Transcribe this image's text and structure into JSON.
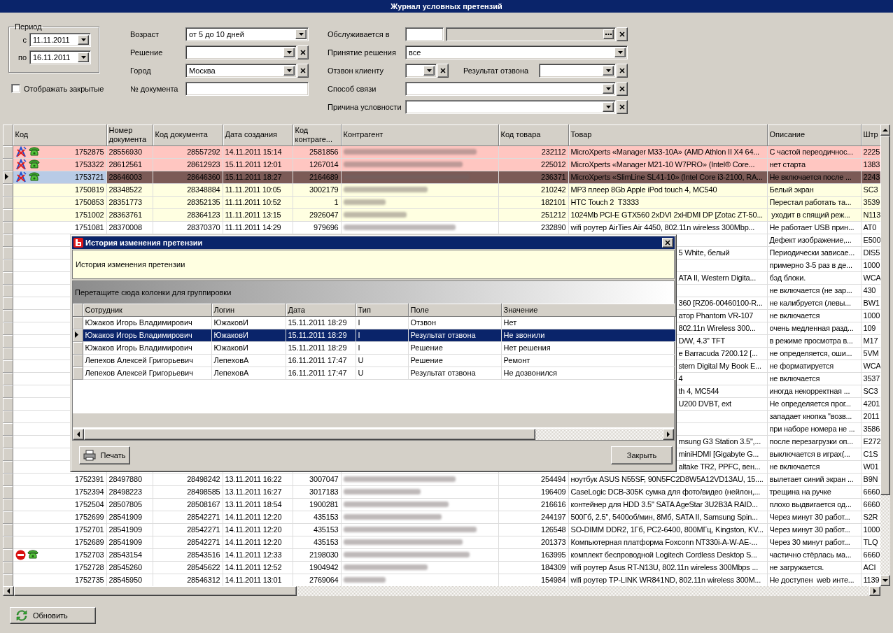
{
  "window": {
    "title": "Журнал условных претензий"
  },
  "filters": {
    "period": {
      "title": "Период",
      "rows": [
        {
          "label": "с",
          "value": "11.11.2011"
        },
        {
          "label": "по",
          "value": "16.11.2011"
        }
      ]
    },
    "show_closed": {
      "label": "Отображать закрытые",
      "checked": false
    },
    "column_1": [
      {
        "kind": "combo",
        "label": "Возраст",
        "value": "от 5 до 10 дней",
        "clearable": false
      },
      {
        "kind": "combo",
        "label": "Решение",
        "clearable": true
      },
      {
        "kind": "combo",
        "label": "Город",
        "value": "Москва",
        "clearable": true
      },
      {
        "kind": "text",
        "label": "№ документа"
      }
    ],
    "column_2": [
      {
        "kind": "lookup",
        "label": "Обслуживается в",
        "clearable": true
      },
      {
        "kind": "combo",
        "label": "Принятие решения",
        "value": "все",
        "clearable": false
      },
      {
        "kind": "pair",
        "label": "Отзвон клиенту",
        "clearable": true,
        "second": {
          "label": "Результат отзвона",
          "clearable": true
        }
      },
      {
        "kind": "combo",
        "label": "Способ связи",
        "clearable": true
      },
      {
        "kind": "combo",
        "label": "Причина условности",
        "clearable": true
      }
    ]
  },
  "grid": {
    "columns": [
      "Код",
      "Номер документа",
      "Код документа",
      "Дата создания",
      "Код контраге...",
      "Контрагент",
      "Код товара",
      "Товар",
      "Описание",
      "Штр"
    ],
    "rows": [
      {
        "kind": "full",
        "selected": false,
        "color": "#ffc6c1",
        "marked": true,
        "blocked": false,
        "called": true,
        "code": "1752875",
        "doc_number": "28556930",
        "doc_code": "28557292",
        "created": "14.11.2011 15:14",
        "counterparty_code": "2581856",
        "product_code": "232112",
        "product": "MicroXperts «Manager M33-10A» (AMD Athlon II X4 64...",
        "description": "С частой переодичнос...",
        "column_11": "2225"
      },
      {
        "kind": "full",
        "selected": false,
        "color": "#ffc6c1",
        "marked": true,
        "blocked": false,
        "called": true,
        "code": "1753322",
        "doc_number": "28612561",
        "doc_code": "28612923",
        "created": "15.11.2011 12:01",
        "counterparty_code": "1267014",
        "product_code": "225012",
        "product": "MicroXperts «Manager M21-10 W7PRO» (Intel® Core...",
        "description": "нет старта",
        "column_11": "1383"
      },
      {
        "kind": "full",
        "selected": true,
        "color": "#ffc6c1",
        "marked": true,
        "blocked": false,
        "called": true,
        "code": "1753721",
        "doc_number": "28646003",
        "doc_code": "28646360",
        "created": "15.11.2011 18:27",
        "counterparty_code": "2164689",
        "product_code": "236371",
        "product": "MicroXperts «SlimLine SL41-10» (Intel Core i3-2100, RA...",
        "description": "Не включается после ...",
        "column_11": "2243"
      },
      {
        "kind": "full",
        "selected": false,
        "color": "#ffffe1",
        "marked": false,
        "blocked": false,
        "called": false,
        "code": "1750819",
        "doc_number": "28348522",
        "doc_code": "28348884",
        "created": "11.11.2011 10:05",
        "counterparty_code": "3002179",
        "product_code": "210242",
        "product": "MP3 плеер 8Gb Apple iPod touch 4, MC540",
        "description": "Белый экран",
        "column_11": "SC3"
      },
      {
        "kind": "full",
        "selected": false,
        "color": "#ffffe1",
        "marked": false,
        "blocked": false,
        "called": false,
        "code": "1750853",
        "doc_number": "28351773",
        "doc_code": "28352135",
        "created": "11.11.2011 10:52",
        "counterparty_code": "1",
        "product_code": "182101",
        "product": "HTC Touch 2  T3333",
        "description": "Перестал работать та...",
        "column_11": "3539"
      },
      {
        "kind": "full",
        "selected": false,
        "color": "#ffffe1",
        "marked": false,
        "blocked": false,
        "called": false,
        "code": "1751002",
        "doc_number": "28363761",
        "doc_code": "28364123",
        "created": "11.11.2011 13:15",
        "counterparty_code": "2926047",
        "product_code": "251212",
        "product": "1024Mb PCI-E GTX560 2xDVI 2xHDMI DP [Zotac ZT-50...",
        "description": " уходит в спящий реж...",
        "column_11": "N113"
      },
      {
        "kind": "full",
        "selected": false,
        "color": "#ffffff",
        "marked": false,
        "blocked": false,
        "called": false,
        "code": "1751081",
        "doc_number": "28370008",
        "doc_code": "28370370",
        "created": "11.11.2011 14:29",
        "counterparty_code": "979696",
        "product_code": "232890",
        "product": "wifi роутер AirTies Air 4450, 802.11n wireless 300Mbp...",
        "description": "Не работает USB прин...",
        "column_11": "AT0"
      },
      {
        "kind": "covered",
        "selected": false,
        "color": "#ffffff",
        "marked": false,
        "blocked": false,
        "called": false,
        "description": "Дефект изображение,...",
        "column_11": "E500"
      },
      {
        "kind": "covered",
        "selected": false,
        "color": "#ffffff",
        "marked": false,
        "blocked": false,
        "called": false,
        "product": "5 White, белый",
        "description": "Периодически зависае...",
        "column_11": "DIS5"
      },
      {
        "kind": "covered",
        "selected": false,
        "color": "#ffffff",
        "marked": false,
        "blocked": false,
        "called": false,
        "description": "примерно 3-5 раз в де...",
        "column_11": "1000"
      },
      {
        "kind": "covered",
        "selected": false,
        "color": "#ffffff",
        "marked": false,
        "blocked": false,
        "called": false,
        "product": "ATA II, Western Digita...",
        "description": "бэд блоки.",
        "column_11": "WCA"
      },
      {
        "kind": "covered",
        "selected": false,
        "color": "#ffffff",
        "marked": false,
        "blocked": false,
        "called": false,
        "description": "не включается (не зар...",
        "column_11": "430"
      },
      {
        "kind": "covered",
        "selected": false,
        "color": "#ffffff",
        "marked": false,
        "blocked": false,
        "called": false,
        "product": "360 [RZ06-00460100-R...",
        "description": "не калибруется (левы...",
        "column_11": "BW1"
      },
      {
        "kind": "covered",
        "selected": false,
        "color": "#ffffff",
        "marked": false,
        "blocked": false,
        "called": false,
        "product": "атор Phantom VR-107",
        "description": "не включается",
        "column_11": "1000"
      },
      {
        "kind": "covered",
        "selected": false,
        "color": "#ffffff",
        "marked": false,
        "blocked": false,
        "called": false,
        "product": "802.11n Wireless 300...",
        "description": "очень медленная разд...",
        "column_11": "109"
      },
      {
        "kind": "covered",
        "selected": false,
        "color": "#ffffff",
        "marked": false,
        "blocked": false,
        "called": false,
        "product": "D/W, 4.3\" TFT",
        "description": "в режиме просмотра в...",
        "column_11": "M17"
      },
      {
        "kind": "covered",
        "selected": false,
        "color": "#ffffff",
        "marked": false,
        "blocked": false,
        "called": false,
        "product": "e Barracuda 7200.12 [...",
        "description": "не определяется, оши...",
        "column_11": "5VM"
      },
      {
        "kind": "covered",
        "selected": false,
        "color": "#ffffff",
        "marked": false,
        "blocked": false,
        "called": false,
        "product": "stern Digital My Book E...",
        "description": "не форматируется",
        "column_11": "WCA"
      },
      {
        "kind": "covered",
        "selected": false,
        "color": "#ffffff",
        "marked": false,
        "blocked": false,
        "called": false,
        "product": "4",
        "description": "не включается",
        "column_11": "3537"
      },
      {
        "kind": "covered",
        "selected": false,
        "color": "#ffffff",
        "marked": false,
        "blocked": false,
        "called": false,
        "product": "th 4, MC544",
        "description": "иногда некорректная ...",
        "column_11": "SC3"
      },
      {
        "kind": "covered",
        "selected": false,
        "color": "#ffffff",
        "marked": false,
        "blocked": false,
        "called": false,
        "product": "U200 DVBT, ext",
        "description": "Не определяется прог...",
        "column_11": "4201"
      },
      {
        "kind": "covered",
        "selected": false,
        "color": "#ffffff",
        "marked": false,
        "blocked": false,
        "called": false,
        "description": "западает кнопка \"возв...",
        "column_11": "2011"
      },
      {
        "kind": "covered",
        "selected": false,
        "color": "#ffffff",
        "marked": false,
        "blocked": false,
        "called": false,
        "description": "при наборе номера не ...",
        "column_11": "3586"
      },
      {
        "kind": "covered",
        "selected": false,
        "color": "#ffffff",
        "marked": false,
        "blocked": false,
        "called": false,
        "product": "msung G3 Station 3.5\",...",
        "description": "после перезагрузки оп...",
        "column_11": "E272"
      },
      {
        "kind": "covered",
        "selected": false,
        "color": "#ffffff",
        "marked": false,
        "blocked": false,
        "called": false,
        "product": "miniHDMI [Gigabyte G...",
        "description": "выключается в играх(...",
        "column_11": "C1S"
      },
      {
        "kind": "covered",
        "selected": false,
        "color": "#ffffff",
        "marked": false,
        "blocked": false,
        "called": false,
        "product": "altake TR2, PPFC, вен...",
        "description": "не включается",
        "column_11": "W01"
      },
      {
        "kind": "full",
        "selected": false,
        "color": "#ffffff",
        "marked": false,
        "blocked": false,
        "called": false,
        "code": "1752391",
        "doc_number": "28497880",
        "doc_code": "28498242",
        "created": "13.11.2011 16:22",
        "counterparty_code": "3007047",
        "product_code": "254494",
        "product": "ноутбук ASUS N55SF, 90N5FC2D8W5A12VD13AU, 15....",
        "description": "вылетает синий экран ...",
        "column_11": "B9N"
      },
      {
        "kind": "full",
        "selected": false,
        "color": "#ffffff",
        "marked": false,
        "blocked": false,
        "called": false,
        "code": "1752394",
        "doc_number": "28498223",
        "doc_code": "28498585",
        "created": "13.11.2011 16:27",
        "counterparty_code": "3017183",
        "product_code": "196409",
        "product": "CaseLogic DCB-305K сумка для фото/видео (нейлон,...",
        "description": "трещина на ручке",
        "column_11": "6660"
      },
      {
        "kind": "full",
        "selected": false,
        "color": "#ffffff",
        "marked": false,
        "blocked": false,
        "called": false,
        "code": "1752504",
        "doc_number": "28507805",
        "doc_code": "28508167",
        "created": "13.11.2011 18:54",
        "counterparty_code": "1900281",
        "product_code": "216616",
        "product": "контейнер для HDD 3.5\" SATA AgeStar 3U2B3A RAID...",
        "description": "плохо выдвигается од...",
        "column_11": "6660"
      },
      {
        "kind": "full",
        "selected": false,
        "color": "#ffffff",
        "marked": false,
        "blocked": false,
        "called": false,
        "code": "1752699",
        "doc_number": "28541909",
        "doc_code": "28542271",
        "created": "14.11.2011 12:20",
        "counterparty_code": "435153",
        "product_code": "244197",
        "product": "500Гб, 2.5\", 5400об/мин, 8Мб, SATA II, Samsung Spin...",
        "description": "Через минут 30 работ...",
        "column_11": "S2R"
      },
      {
        "kind": "full",
        "selected": false,
        "color": "#ffffff",
        "marked": false,
        "blocked": false,
        "called": false,
        "code": "1752701",
        "doc_number": "28541909",
        "doc_code": "28542271",
        "created": "14.11.2011 12:20",
        "counterparty_code": "435153",
        "product_code": "126548",
        "product": "SO-DIMM DDR2, 1Гб, PC2-6400, 800МГц, Kingston, KV...",
        "description": "Через минут 30 работ...",
        "column_11": "1000"
      },
      {
        "kind": "full",
        "selected": false,
        "color": "#ffffff",
        "marked": false,
        "blocked": false,
        "called": false,
        "code": "1752689",
        "doc_number": "28541909",
        "doc_code": "28542271",
        "created": "14.11.2011 12:20",
        "counterparty_code": "435153",
        "product_code": "201373",
        "product": "Компьютерная платформа Foxconn NT330i-A-W-AE-...",
        "description": "Через 30 минут работ...",
        "column_11": "TLQ"
      },
      {
        "kind": "full",
        "selected": false,
        "color": "#ffffff",
        "marked": false,
        "blocked": true,
        "called": true,
        "code": "1752703",
        "doc_number": "28543154",
        "doc_code": "28543516",
        "created": "14.11.2011 12:33",
        "counterparty_code": "2198030",
        "product_code": "163995",
        "product": "комплект беспроводной Logitech Cordless Desktop S...",
        "description": "частично стёрлась ма...",
        "column_11": "6660"
      },
      {
        "kind": "full",
        "selected": false,
        "color": "#ffffff",
        "marked": false,
        "blocked": false,
        "called": false,
        "code": "1752728",
        "doc_number": "28545260",
        "doc_code": "28545622",
        "created": "14.11.2011 12:52",
        "counterparty_code": "1904942",
        "product_code": "184309",
        "product": "wifi роутер Asus RT-N13U, 802.11n wireless 300Mbps ...",
        "description": "не загружается.",
        "column_11": "ACI"
      },
      {
        "kind": "full",
        "selected": false,
        "color": "#ffffff",
        "marked": false,
        "blocked": false,
        "called": false,
        "code": "1752735",
        "doc_number": "28545950",
        "doc_code": "28546312",
        "created": "14.11.2011 13:01",
        "counterparty_code": "2769064",
        "product_code": "154984",
        "product": "wifi роутер TP-LINK WR841ND, 802.11n wireless 300M...",
        "description": "Не доступен  web инте...",
        "column_11": "1139"
      }
    ]
  },
  "history_dialog": {
    "title": "История изменения претензии",
    "caption": "История изменения претензии",
    "group_hint": "Перетащите сюда колонки для группировки",
    "columns": [
      "Сотрудник",
      "Логин",
      "Дата",
      "Тип",
      "Поле",
      "Значение"
    ],
    "rows": [
      {
        "selected": false,
        "cells": [
          "Южаков Игорь Владимирович",
          "ЮжаковИ",
          "15.11.2011 18:29",
          "I",
          "Отзвон",
          "Нет"
        ]
      },
      {
        "selected": true,
        "cells": [
          "Южаков Игорь Владимирович",
          "ЮжаковИ",
          "15.11.2011 18:29",
          "I",
          "Результат отзвона",
          "Не звонили"
        ]
      },
      {
        "selected": false,
        "cells": [
          "Южаков Игорь Владимирович",
          "ЮжаковИ",
          "15.11.2011 18:29",
          "I",
          "Решение",
          "Нет решения"
        ]
      },
      {
        "selected": false,
        "cells": [
          "Лепехов Алексей Григорьевич",
          "ЛепеховА",
          "16.11.2011 17:47",
          "U",
          "Решение",
          "Ремонт"
        ]
      },
      {
        "selected": false,
        "cells": [
          "Лепехов Алексей Григорьевич",
          "ЛепеховА",
          "16.11.2011 17:47",
          "U",
          "Результат отзвона",
          "Не дозвонился"
        ]
      }
    ],
    "buttons": [
      {
        "kind": "print",
        "label": "Печать"
      },
      {
        "kind": "plain",
        "label": "Закрыть"
      }
    ]
  },
  "footer": {
    "refresh_button": "Обновить"
  }
}
